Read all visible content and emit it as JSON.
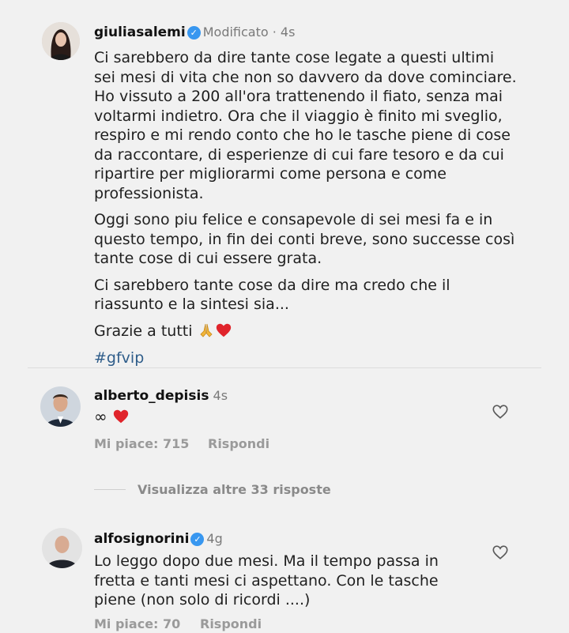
{
  "post": {
    "username": "giuliasalemi",
    "edited_label": "Modificato",
    "time": "4s",
    "paragraphs": [
      "Ci sarebbero da dire tante cose legate a questi ultimi sei mesi di vita che non so davvero da dove cominciare.  Ho vissuto a 200 all'ora trattenendo il fiato, senza mai voltarmi indietro. Ora che il viaggio è finito mi sveglio, respiro e mi rendo conto che ho le tasche piene di cose da raccontare, di esperienze di cui fare tesoro e da cui ripartire per migliorarmi come persona e come professionista.",
      "Oggi sono piu felice e consapevole di sei mesi fa e in questo tempo, in fin dei conti breve, sono successe così tante cose di cui essere grata.",
      "Ci sarebbero tante cose da dire ma credo che il riassunto e la sintesi sia..."
    ],
    "thanks_text": "Grazie a tutti",
    "thanks_emoji_1": "pray-emoji",
    "thanks_emoji_2": "red-heart-emoji",
    "hashtag": "#gfvip"
  },
  "comments": [
    {
      "username": "alberto_depisis",
      "time": "4s",
      "text": "∞",
      "emoji": "red-heart-emoji",
      "likes_label": "Mi piace: 715",
      "reply_label": "Rispondi"
    },
    {
      "username": "alfosignorini",
      "time": "4g",
      "text": "Lo leggo dopo due mesi. Ma il tempo passa in fretta e tanti mesi ci aspettano. Con le tasche piene (non solo di ricordi ....)",
      "likes_label": "Mi piace: 70",
      "reply_label": "Rispondi"
    }
  ],
  "view_more_replies": "Visualizza altre 33 risposte",
  "colors": {
    "background": "#f1f1f1",
    "verified": "#3897f0",
    "heart": "#e0242b",
    "hashtag": "#2f5d8a",
    "muted": "#9a9a9a"
  }
}
